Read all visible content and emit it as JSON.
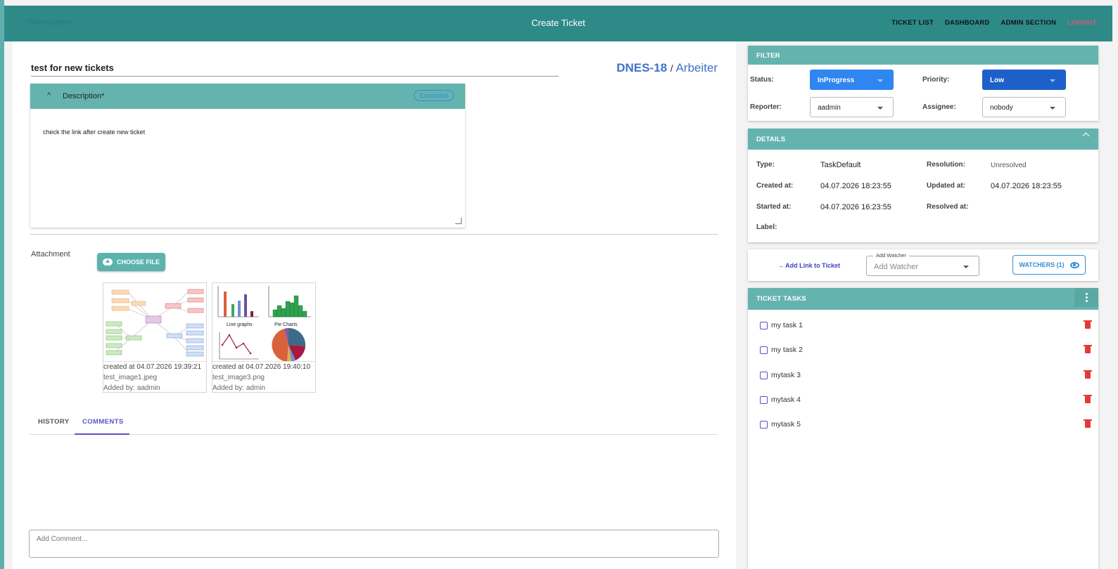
{
  "header": {
    "brand": "Ticketsystem",
    "title": "Create Ticket",
    "nav": [
      "TICKET LIST",
      "DASHBOARD",
      "ADMIN SECTION",
      "LOGOUT"
    ]
  },
  "ticket": {
    "title": "test for new tickets",
    "key": "DNES-18",
    "separator": "/",
    "assignee_group": "Arbeiter"
  },
  "description": {
    "label": "Description*",
    "badge": "Expanded",
    "text": "check the link after create new ticket"
  },
  "attachment": {
    "label": "Attachment",
    "button": "CHOOSE FILE",
    "files": [
      {
        "created": "created at 04.07.2026 19:39:21",
        "name": "test_image1.jpeg",
        "added_by": "Added by: aadmin"
      },
      {
        "created": "created at 04.07.2026 19:40:10",
        "name": "test_image3.png",
        "added_by": "Added by: admin"
      }
    ],
    "preview_texts": {
      "line_graphs": "Line graphs",
      "pie_charts": "Pie Charts"
    }
  },
  "tabs": [
    "HISTORY",
    "COMMENTS"
  ],
  "comment": {
    "placeholder": "Add Comment..."
  },
  "filter": {
    "title": "FILTER",
    "status_label": "Status:",
    "status_value": "InProgress",
    "priority_label": "Priority:",
    "priority_value": "Low",
    "reporter_label": "Reporter:",
    "reporter_value": "aadmin",
    "assignee_label": "Assignee:",
    "assignee_value": "nobody"
  },
  "details": {
    "title": "DETAILS",
    "type_label": "Type:",
    "type_value": "TaskDefault",
    "resolution_label": "Resolution:",
    "resolution_value": "Unresolved",
    "created_label": "Created at:",
    "created_value": "04.07.2026 18:23:55",
    "updated_label": "Updated at:",
    "updated_value": "04.07.2026 18:23:55",
    "started_label": "Started at:",
    "started_value": "04.07.2026 16:23:55",
    "resolved_label": "Resolved at:",
    "label_label": "Label:"
  },
  "links": {
    "add_link": "→ Add Link to Ticket",
    "watcher_float_label": "Add Watcher",
    "watcher_placeholder": "Add Watcher",
    "watchers_button": "WATCHERS (1)"
  },
  "tasks": {
    "title": "TICKET TASKS",
    "items": [
      "my task 1",
      "my task 2",
      "mytask 3",
      "mytask 4",
      "mytask 5"
    ]
  },
  "colors": {
    "topbar": "#2e8a87",
    "card_header": "#65b3af",
    "accent": "#5753c9",
    "status_blue": "#2f86f0",
    "priority_blue": "#1e60c9",
    "delete_red": "#e53935"
  }
}
